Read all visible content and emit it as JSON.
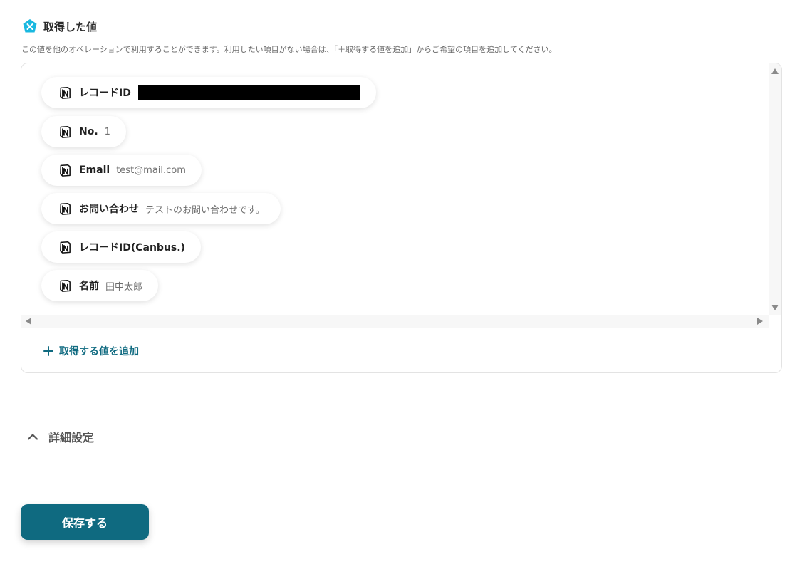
{
  "section": {
    "title": "取得した値",
    "description": "この値を他のオペレーションで利用することができます。利用したい項目がない場合は、「＋取得する値を追加」からご希望の項目を追加してください。",
    "icon": "yoom-app-icon",
    "icon_color": "#1ab8e0"
  },
  "values": [
    {
      "icon": "notion-icon",
      "label": "レコードID",
      "value": "",
      "redacted": true
    },
    {
      "icon": "notion-icon",
      "label": "No.",
      "value": "1"
    },
    {
      "icon": "notion-icon",
      "label": "Email",
      "value": "test@mail.com"
    },
    {
      "icon": "notion-icon",
      "label": "お問い合わせ",
      "value": "テストのお問い合わせです。"
    },
    {
      "icon": "notion-icon",
      "label": "レコードID(Canbus.)",
      "value": ""
    },
    {
      "icon": "notion-icon",
      "label": "名前",
      "value": "田中太郎"
    }
  ],
  "add_value": {
    "label": "取得する値を追加",
    "icon": "plus-icon"
  },
  "advanced": {
    "label": "詳細設定",
    "icon": "chevron-up-icon",
    "expanded": true
  },
  "save_button": {
    "label": "保存する"
  },
  "colors": {
    "accent": "#0f6a80",
    "brand": "#1ab8e0"
  }
}
